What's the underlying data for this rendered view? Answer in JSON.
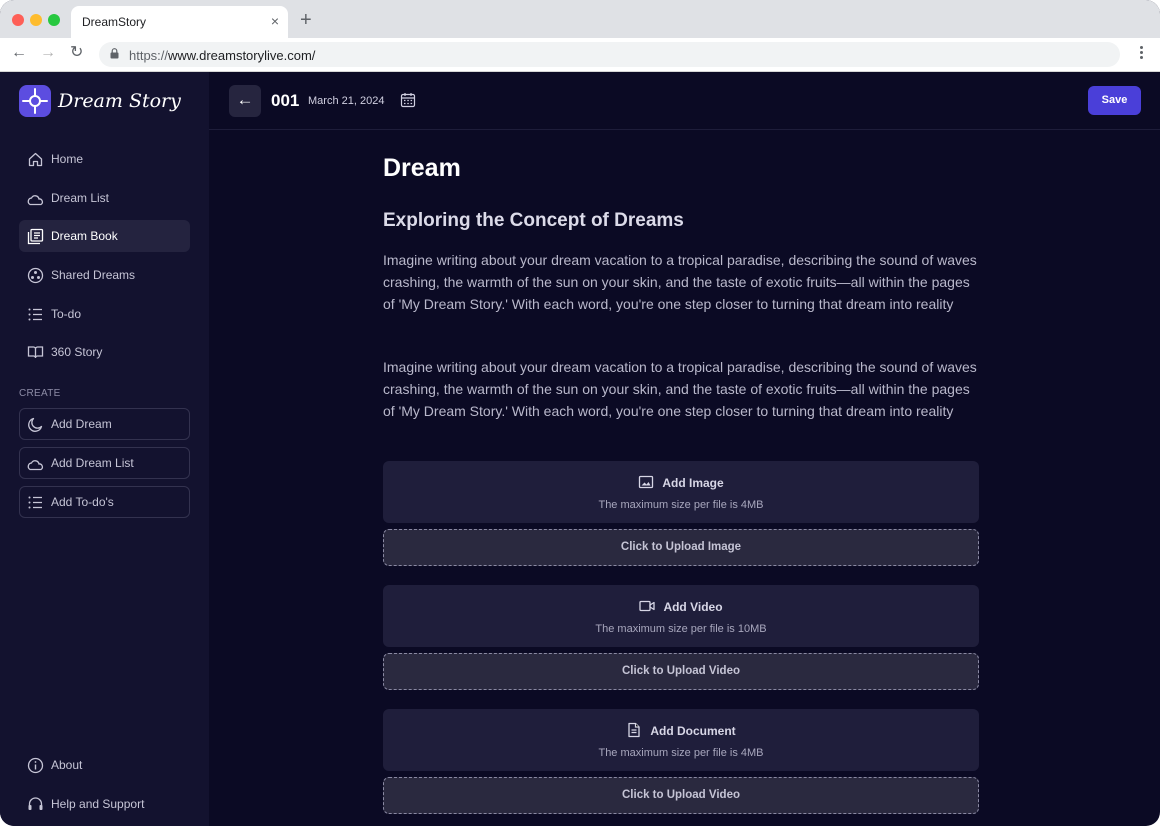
{
  "browser": {
    "tab_title": "DreamStory",
    "tab_close": "×",
    "new_tab": "+",
    "url_scheme": "https://",
    "url_rest": "www.dreamstorylive.com/"
  },
  "sidebar": {
    "logo_text": "Dream Story",
    "nav": [
      {
        "label": "Home",
        "icon": "home-icon"
      },
      {
        "label": "Dream List",
        "icon": "dream-list-icon"
      },
      {
        "label": "Dream Book",
        "icon": "book-icon",
        "active": true
      },
      {
        "label": "Shared Dreams",
        "icon": "shared-icon"
      },
      {
        "label": "To-do",
        "icon": "list-icon"
      },
      {
        "label": "360 Story",
        "icon": "story-icon"
      }
    ],
    "create_label": "CREATE",
    "create": [
      {
        "label": "Add Dream",
        "icon": "moon-icon"
      },
      {
        "label": "Add Dream List",
        "icon": "dream-list-icon"
      },
      {
        "label": "Add To-do's",
        "icon": "list-icon"
      }
    ],
    "footer": [
      {
        "label": "About",
        "icon": "info-icon"
      },
      {
        "label": "Help and Support",
        "icon": "support-icon"
      }
    ]
  },
  "header": {
    "back_arrow": "←",
    "entry_number": "001",
    "entry_date": "March 21, 2024",
    "save_label": "Save"
  },
  "main": {
    "title": "Dream",
    "subtitle": "Exploring the Concept of Dreams",
    "paragraphs": [
      "Imagine writing about your dream vacation to a tropical paradise, describing the sound of waves crashing, the warmth of the sun on your skin, and the taste of exotic fruits—all within the pages of 'My Dream Story.' With each word, you're one step closer to turning that dream into reality",
      "Imagine writing about your dream vacation to a tropical paradise, describing the sound of waves crashing, the warmth of the sun on your skin, and the taste of exotic fruits—all within the pages of 'My Dream Story.' With each word, you're one step closer to turning that dream into reality"
    ],
    "uploads": [
      {
        "title": "Add Image",
        "note": "The maximum size per file is 4MB",
        "button": "Click to Upload Image",
        "icon": "image-icon"
      },
      {
        "title": "Add Video",
        "note": "The maximum size per file is 10MB",
        "button": "Click to Upload Video",
        "icon": "video-icon"
      },
      {
        "title": "Add Document",
        "note": "The maximum size per file is 4MB",
        "button": "Click to Upload Video",
        "icon": "document-icon"
      }
    ]
  },
  "colors": {
    "accent": "#4a3fd9",
    "background": "#0b0a24",
    "sidebar": "#13122f"
  }
}
